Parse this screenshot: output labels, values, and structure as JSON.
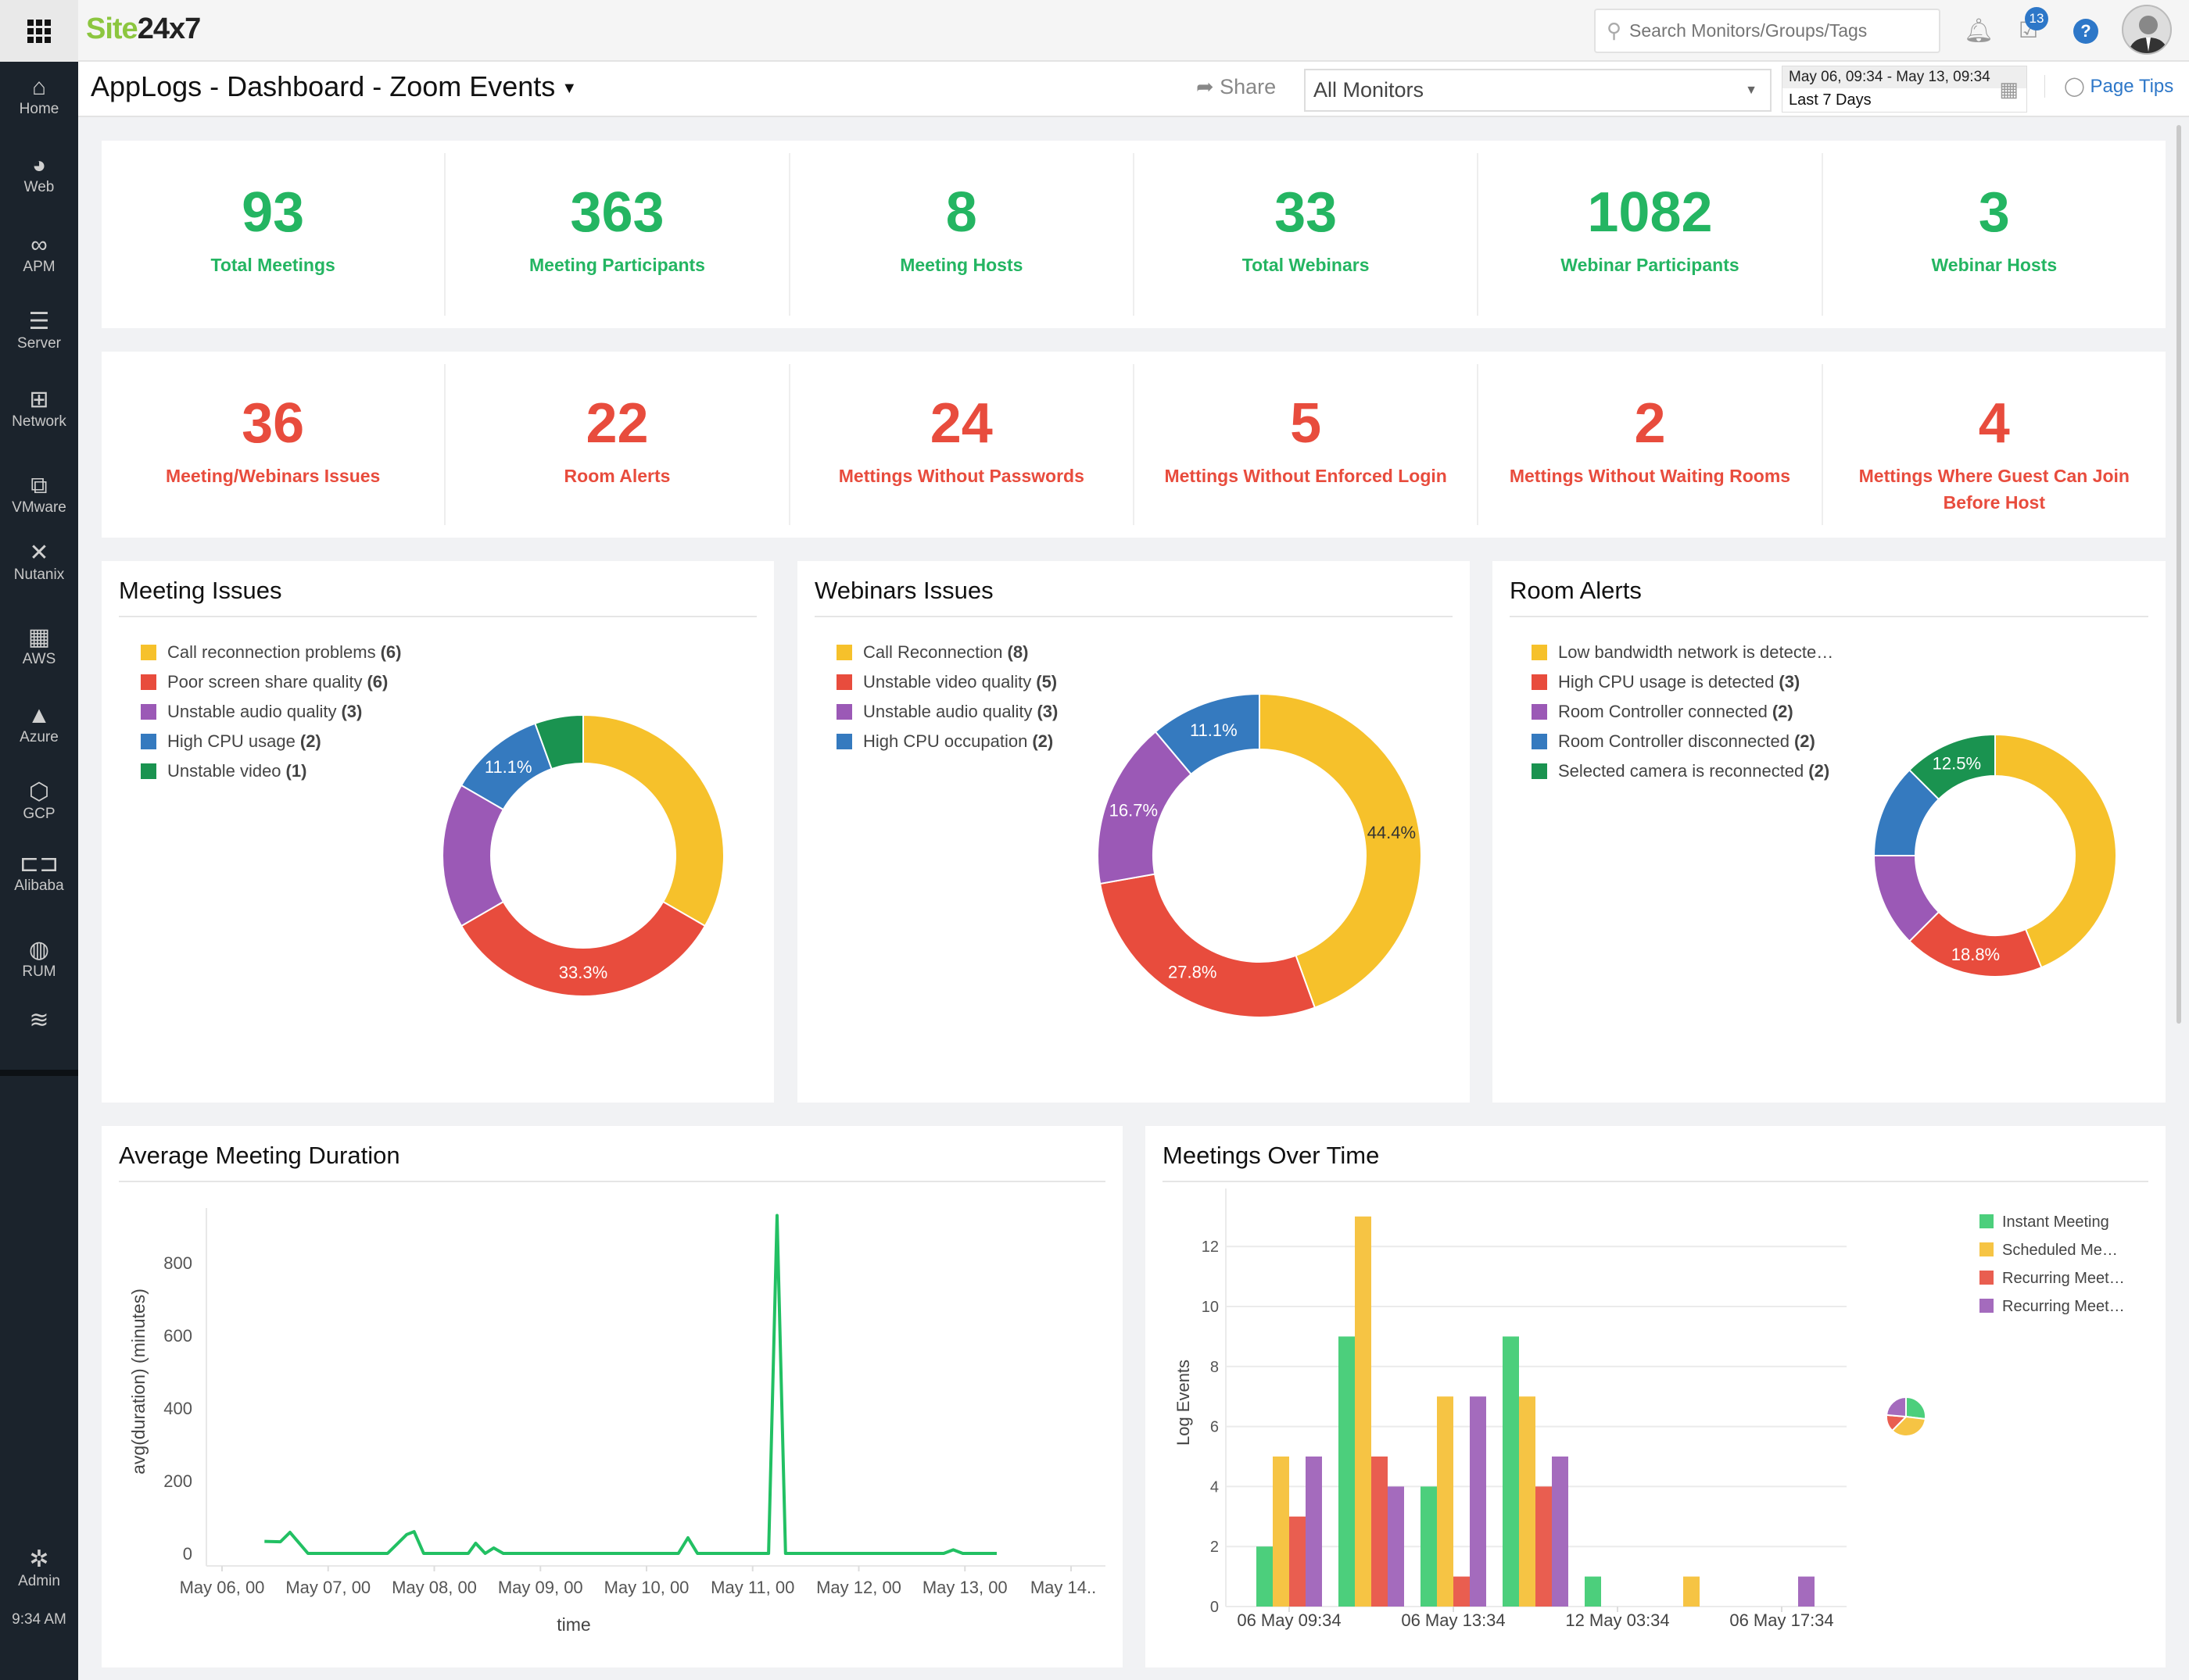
{
  "topbar": {
    "logo_green": "Site",
    "logo_dark": "24x7",
    "search_placeholder": "Search Monitors/Groups/Tags",
    "notifications_badge": "13",
    "help_label": "?"
  },
  "sidebar": {
    "items": [
      {
        "label": "Home",
        "icon": "home-icon"
      },
      {
        "label": "Web",
        "icon": "globe-icon"
      },
      {
        "label": "APM",
        "icon": "binoculars-icon"
      },
      {
        "label": "Server",
        "icon": "server-icon"
      },
      {
        "label": "Network",
        "icon": "network-icon"
      },
      {
        "label": "VMware",
        "icon": "vmware-icon"
      },
      {
        "label": "Nutanix",
        "icon": "nutanix-icon"
      },
      {
        "label": "AWS",
        "icon": "aws-icon"
      },
      {
        "label": "Azure",
        "icon": "azure-icon"
      },
      {
        "label": "GCP",
        "icon": "gcp-icon"
      },
      {
        "label": "Alibaba",
        "icon": "alibaba-icon"
      },
      {
        "label": "RUM",
        "icon": "rum-icon"
      },
      {
        "label": "",
        "icon": "layers-icon"
      }
    ],
    "admin_label": "Admin",
    "time": "9:34 AM"
  },
  "header": {
    "title": "AppLogs - Dashboard - Zoom Events",
    "share_label": "Share",
    "monitor_select": "All Monitors",
    "date_range": "May 06, 09:34 - May 13, 09:34",
    "period": "Last 7 Days",
    "page_tips": "Page Tips"
  },
  "colors": {
    "good": "#24b562",
    "bad": "#e84c3d"
  },
  "kpis_top": [
    {
      "value": "93",
      "label": "Total Meetings"
    },
    {
      "value": "363",
      "label": "Meeting Participants"
    },
    {
      "value": "8",
      "label": "Meeting Hosts"
    },
    {
      "value": "33",
      "label": "Total Webinars"
    },
    {
      "value": "1082",
      "label": "Webinar Participants"
    },
    {
      "value": "3",
      "label": "Webinar Hosts"
    }
  ],
  "kpis_bottom": [
    {
      "value": "36",
      "label": "Meeting/Webinars Issues"
    },
    {
      "value": "22",
      "label": "Room Alerts"
    },
    {
      "value": "24",
      "label": "Mettings Without Passwords"
    },
    {
      "value": "5",
      "label": "Mettings Without Enforced Login"
    },
    {
      "value": "2",
      "label": "Mettings Without Waiting Rooms"
    },
    {
      "value": "4",
      "label": "Mettings Where Guest Can Join Before Host"
    }
  ],
  "chart_data": [
    {
      "type": "pie",
      "title": "Meeting Issues",
      "donut": true,
      "legend": "left",
      "slices": [
        {
          "label": "Call reconnection problems",
          "count": "(6)",
          "value": 6,
          "color": "#f6c12b",
          "shown_label": ""
        },
        {
          "label": "Poor screen share quality",
          "count": "(6)",
          "value": 6,
          "color": "#e84c3d",
          "shown_label": "33.3%"
        },
        {
          "label": "Unstable audio quality",
          "count": "(3)",
          "value": 3,
          "color": "#9b59b6",
          "shown_label": ""
        },
        {
          "label": "High CPU usage",
          "count": "(2)",
          "value": 2,
          "color": "#357abf",
          "shown_label": "11.1%"
        },
        {
          "label": "Unstable video",
          "count": "(1)",
          "value": 1,
          "color": "#1a9350",
          "shown_label": ""
        }
      ]
    },
    {
      "type": "pie",
      "title": "Webinars Issues",
      "donut": true,
      "legend": "left",
      "slices": [
        {
          "label": "Call Reconnection",
          "count": "(8)",
          "value": 8,
          "color": "#f6c12b",
          "shown_label": "44.4%"
        },
        {
          "label": "Unstable video quality",
          "count": "(5)",
          "value": 5,
          "color": "#e84c3d",
          "shown_label": "27.8%"
        },
        {
          "label": "Unstable audio quality",
          "count": "(3)",
          "value": 3,
          "color": "#9b59b6",
          "shown_label": "16.7%"
        },
        {
          "label": "High CPU occupation",
          "count": "(2)",
          "value": 2,
          "color": "#357abf",
          "shown_label": "11.1%"
        }
      ]
    },
    {
      "type": "pie",
      "title": "Room Alerts",
      "donut": true,
      "legend": "left",
      "slices": [
        {
          "label": "Low bandwidth network is detecte…",
          "count": "",
          "value": 7,
          "color": "#f6c12b",
          "shown_label": ""
        },
        {
          "label": "High CPU usage is detected",
          "count": "(3)",
          "value": 3,
          "color": "#e84c3d",
          "shown_label": "18.8%"
        },
        {
          "label": "Room Controller connected",
          "count": "(2)",
          "value": 2,
          "color": "#9b59b6",
          "shown_label": ""
        },
        {
          "label": "Room Controller disconnected",
          "count": "(2)",
          "value": 2,
          "color": "#357abf",
          "shown_label": ""
        },
        {
          "label": "Selected camera is reconnected",
          "count": "(2)",
          "value": 2,
          "color": "#1a9350",
          "shown_label": "12.5%"
        }
      ]
    },
    {
      "type": "line",
      "title": "Average Meeting Duration",
      "xlabel": "time",
      "ylabel": "avg(duration) (minutes)",
      "ylim": [
        0,
        800
      ],
      "yticks": [
        0,
        200,
        400,
        600,
        800
      ],
      "xticks": [
        "May 06, 00",
        "May 07, 00",
        "May 08, 00",
        "May 09, 00",
        "May 10, 00",
        "May 11, 00",
        "May 12, 00",
        "May 13, 00",
        "May 14.."
      ],
      "color": "#22c063",
      "grid": false,
      "points": [
        {
          "x": "May 06, 09:36",
          "y": 33
        },
        {
          "x": "May 06, 13:12",
          "y": 32
        },
        {
          "x": "May 06, 15:22",
          "y": 58
        },
        {
          "x": "May 06, 19:26",
          "y": 0
        },
        {
          "x": "May 07, 13:26",
          "y": 0
        },
        {
          "x": "May 07, 17:46",
          "y": 52
        },
        {
          "x": "May 07, 19:26",
          "y": 60
        },
        {
          "x": "May 07, 21:36",
          "y": 0
        },
        {
          "x": "May 08, 07:41",
          "y": 0
        },
        {
          "x": "May 08, 09:22",
          "y": 28
        },
        {
          "x": "May 08, 11:31",
          "y": 0
        },
        {
          "x": "May 08, 13:26",
          "y": 15
        },
        {
          "x": "May 08, 15:36",
          "y": 0
        },
        {
          "x": "May 10, 07:12",
          "y": 0
        },
        {
          "x": "May 10, 09:22",
          "y": 43
        },
        {
          "x": "May 10, 11:31",
          "y": 0
        },
        {
          "x": "May 11, 03:36",
          "y": 0
        },
        {
          "x": "May 11, 05:31",
          "y": 930
        },
        {
          "x": "May 11, 07:26",
          "y": 0
        },
        {
          "x": "May 12, 19:12",
          "y": 0
        },
        {
          "x": "May 12, 21:22",
          "y": 10
        },
        {
          "x": "May 12, 23:31",
          "y": 0
        },
        {
          "x": "May 13, 07:12",
          "y": 0
        }
      ]
    },
    {
      "type": "bar",
      "title": "Meetings Over Time",
      "ylabel": "Log Events",
      "ylim": [
        0,
        13
      ],
      "yticks": [
        0,
        2,
        4,
        6,
        8,
        10,
        12
      ],
      "grid": true,
      "legend": "right",
      "categories": [
        "06 May 09:34",
        "",
        "06 May 13:34",
        "",
        "12 May 03:34",
        "",
        "06 May 17:34"
      ],
      "series": [
        {
          "name": "Instant Meeting",
          "color": "#4ccf7c",
          "values": [
            2,
            9,
            4,
            9,
            1,
            0,
            0
          ]
        },
        {
          "name": "Scheduled Me…",
          "color": "#f6c444",
          "values": [
            5,
            13,
            7,
            7,
            0,
            1,
            0
          ]
        },
        {
          "name": "Recurring Meet…",
          "color": "#e95e50",
          "values": [
            3,
            5,
            1,
            4,
            0,
            0,
            0
          ]
        },
        {
          "name": "Recurring Meet…",
          "color": "#a46bbd",
          "values": [
            5,
            4,
            7,
            5,
            0,
            0,
            1
          ]
        }
      ]
    }
  ]
}
